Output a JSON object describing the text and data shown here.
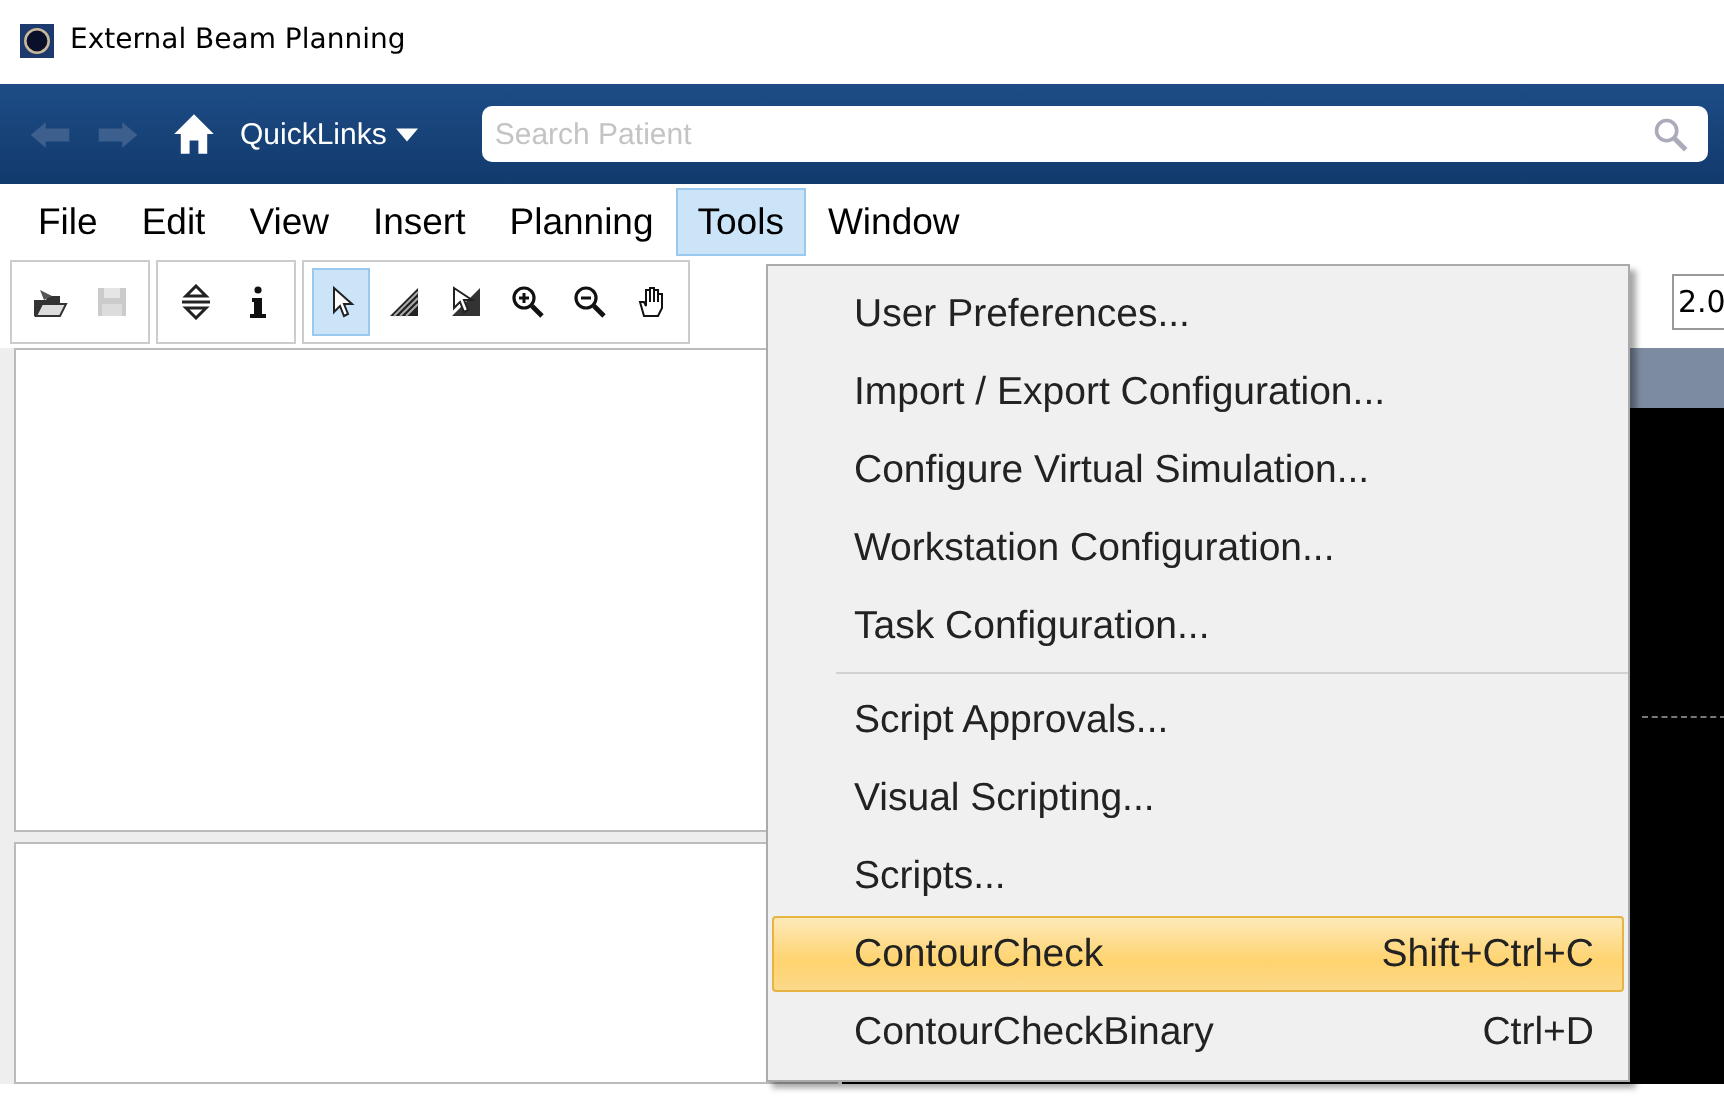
{
  "window": {
    "title": "External Beam Planning"
  },
  "navbar": {
    "quicklinks": "QuickLinks",
    "search": {
      "placeholder": "Search Patient"
    }
  },
  "menubar": [
    {
      "label": "File",
      "selected": false
    },
    {
      "label": "Edit",
      "selected": false
    },
    {
      "label": "View",
      "selected": false
    },
    {
      "label": "Insert",
      "selected": false
    },
    {
      "label": "Planning",
      "selected": false
    },
    {
      "label": "Tools",
      "selected": true
    },
    {
      "label": "Window",
      "selected": false
    }
  ],
  "toolbar": {
    "groups": [
      [
        {
          "kind": "folder",
          "selected": false,
          "disabled": false
        },
        {
          "kind": "disk",
          "selected": false,
          "disabled": true
        }
      ],
      [
        {
          "kind": "move",
          "selected": false,
          "disabled": false
        },
        {
          "kind": "info",
          "selected": false,
          "disabled": false
        }
      ],
      [
        {
          "kind": "pointer",
          "selected": true,
          "disabled": false
        },
        {
          "kind": "hatch",
          "selected": false,
          "disabled": false
        },
        {
          "kind": "pointerhatch",
          "selected": false,
          "disabled": false
        },
        {
          "kind": "zoomin",
          "selected": false,
          "disabled": false
        },
        {
          "kind": "zoomout",
          "selected": false,
          "disabled": false
        },
        {
          "kind": "hand",
          "selected": false,
          "disabled": false
        }
      ]
    ],
    "zoom_value": "2.0"
  },
  "tools_menu": {
    "sections": [
      [
        {
          "label": "User Preferences...",
          "selected": false
        },
        {
          "label": "Import / Export Configuration...",
          "selected": false
        },
        {
          "label": "Configure Virtual Simulation...",
          "selected": false
        },
        {
          "label": "Workstation Configuration...",
          "selected": false
        },
        {
          "label": "Task Configuration...",
          "selected": false
        }
      ],
      [
        {
          "label": "Script Approvals...",
          "selected": false
        },
        {
          "label": "Visual Scripting...",
          "selected": false
        },
        {
          "label": "Scripts...",
          "selected": false
        },
        {
          "label": "ContourCheck",
          "shortcut": "Shift+Ctrl+C",
          "selected": true
        },
        {
          "label": "ContourCheckBinary",
          "shortcut": "Ctrl+D",
          "selected": false
        }
      ]
    ]
  }
}
